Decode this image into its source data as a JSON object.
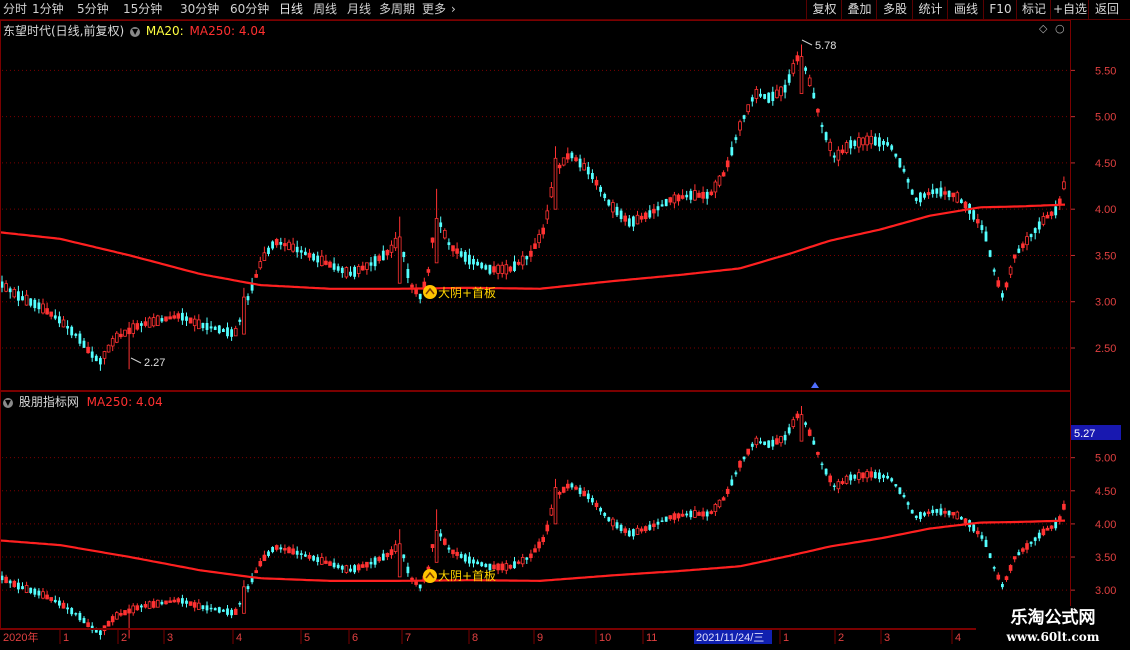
{
  "toolbar": {
    "periods": [
      "分时",
      "1分钟",
      "5分钟",
      "15分钟",
      "30分钟",
      "60分钟",
      "日线",
      "周线",
      "月线",
      "多周期",
      "更多"
    ],
    "active_period": "日线",
    "right_buttons": [
      "复权",
      "叠加",
      "多股",
      "统计",
      "画线",
      "F10",
      "标记",
      "+自选",
      "返回"
    ]
  },
  "main_pane": {
    "stock_title": "东望时代(日线,前复权)",
    "ma20_label": "MA20:",
    "ma250_label": "MA250: 4.04",
    "high_marker": "5.78",
    "low_marker": "2.27",
    "signal_text": "大阴+首板"
  },
  "sub_pane": {
    "title": "股朋指标网",
    "ma250_label": "MA250: 4.04",
    "price_tag": "5.27",
    "signal_text": "大阴+首板"
  },
  "date_axis": {
    "year_label": "2020年",
    "months": [
      "1",
      "2",
      "3",
      "4",
      "5",
      "6",
      "7",
      "8",
      "9",
      "10",
      "11",
      "1",
      "2",
      "3",
      "4"
    ],
    "cursor_date": "2021/11/24/三"
  },
  "watermark": {
    "title": "乐淘公式网",
    "url": "www.60lt.com"
  },
  "colors": {
    "up": "#ff3232",
    "down": "#54ffff",
    "ma250": "#ff2020",
    "axis": "#e04040",
    "signal": "#ffd400"
  },
  "chart_data": {
    "type": "candlestick",
    "main_y_ticks": [
      2.5,
      3.0,
      3.5,
      4.0,
      4.5,
      5.0,
      5.5
    ],
    "sub_y_ticks": [
      3.0,
      3.5,
      4.0,
      4.5,
      5.0
    ],
    "main_ylim": [
      2.1,
      5.85
    ],
    "sub_ylim": [
      2.7,
      5.75
    ],
    "price_anchors": [
      [
        0,
        3.2
      ],
      [
        20,
        3.05
      ],
      [
        40,
        2.95
      ],
      [
        60,
        2.8
      ],
      [
        80,
        2.6
      ],
      [
        90,
        2.45
      ],
      [
        100,
        2.35
      ],
      [
        115,
        2.6
      ],
      [
        140,
        2.75
      ],
      [
        160,
        2.8
      ],
      [
        180,
        2.85
      ],
      [
        200,
        2.75
      ],
      [
        220,
        2.7
      ],
      [
        235,
        2.65
      ],
      [
        245,
        2.95
      ],
      [
        262,
        3.45
      ],
      [
        275,
        3.65
      ],
      [
        290,
        3.6
      ],
      [
        310,
        3.5
      ],
      [
        330,
        3.4
      ],
      [
        350,
        3.3
      ],
      [
        370,
        3.4
      ],
      [
        390,
        3.55
      ],
      [
        400,
        3.7
      ],
      [
        410,
        3.2
      ],
      [
        420,
        3.05
      ],
      [
        428,
        3.3
      ],
      [
        436,
        3.95
      ],
      [
        450,
        3.6
      ],
      [
        470,
        3.45
      ],
      [
        490,
        3.35
      ],
      [
        510,
        3.35
      ],
      [
        530,
        3.5
      ],
      [
        545,
        3.8
      ],
      [
        555,
        4.4
      ],
      [
        570,
        4.6
      ],
      [
        590,
        4.4
      ],
      [
        610,
        4.05
      ],
      [
        630,
        3.85
      ],
      [
        650,
        3.95
      ],
      [
        670,
        4.1
      ],
      [
        690,
        4.15
      ],
      [
        710,
        4.15
      ],
      [
        725,
        4.4
      ],
      [
        740,
        4.9
      ],
      [
        755,
        5.25
      ],
      [
        770,
        5.2
      ],
      [
        785,
        5.3
      ],
      [
        800,
        5.7
      ],
      [
        812,
        5.3
      ],
      [
        822,
        4.9
      ],
      [
        835,
        4.55
      ],
      [
        850,
        4.7
      ],
      [
        870,
        4.75
      ],
      [
        890,
        4.7
      ],
      [
        905,
        4.4
      ],
      [
        915,
        4.1
      ],
      [
        935,
        4.2
      ],
      [
        955,
        4.15
      ],
      [
        970,
        4.0
      ],
      [
        985,
        3.75
      ],
      [
        995,
        3.3
      ],
      [
        1003,
        3.05
      ],
      [
        1015,
        3.5
      ],
      [
        1030,
        3.7
      ],
      [
        1045,
        3.9
      ],
      [
        1058,
        4.0
      ],
      [
        1066,
        4.35
      ]
    ],
    "ma250_anchors": [
      [
        0,
        3.75
      ],
      [
        60,
        3.68
      ],
      [
        130,
        3.5
      ],
      [
        200,
        3.3
      ],
      [
        260,
        3.18
      ],
      [
        330,
        3.14
      ],
      [
        400,
        3.14
      ],
      [
        470,
        3.15
      ],
      [
        540,
        3.14
      ],
      [
        610,
        3.22
      ],
      [
        680,
        3.29
      ],
      [
        740,
        3.36
      ],
      [
        790,
        3.52
      ],
      [
        830,
        3.66
      ],
      [
        880,
        3.78
      ],
      [
        930,
        3.93
      ],
      [
        980,
        4.02
      ],
      [
        1020,
        4.03
      ],
      [
        1066,
        4.05
      ]
    ]
  }
}
